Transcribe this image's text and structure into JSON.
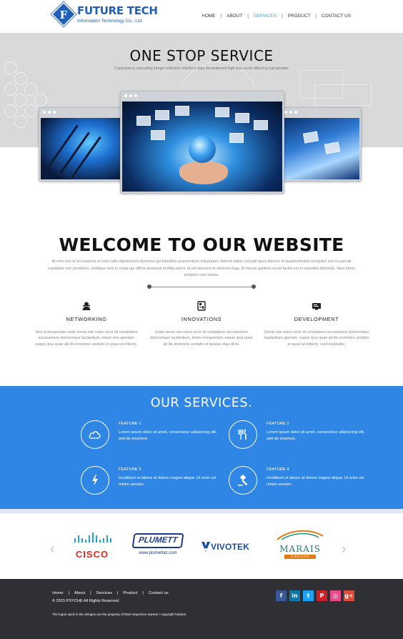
{
  "header": {
    "logo": {
      "name": "FUTURE TECH",
      "sub": "Information Technology Co., Ltd."
    },
    "nav": [
      {
        "label": "HOME",
        "active": false
      },
      {
        "label": "ABOUT",
        "active": false
      },
      {
        "label": "SERVICES",
        "active": true
      },
      {
        "label": "PRODUCT",
        "active": false
      },
      {
        "label": "CONTACT US",
        "active": false
      }
    ]
  },
  "hero": {
    "title": "ONE STOP SERVICE",
    "subtitle": "Capacitance cascading integer reflective interface data development high bus cache dithering transponder"
  },
  "welcome": {
    "title": "WELCOME TO OUR WEBSITE",
    "text": "At vero eos et accusamus et iusto odio dignissimos ducimus qui blanditiis praesentium voluptatum deleniti atque corrupti quos dolores et quasmolestias excepturi sint occaecati cupiditate non provident, similique sunt in culpa qui officia deserunt mollitia animi, id est laborum et dolorum fuga. Et harum quidem rerum facilis est et expedita distinctio. Nam libero tempore cum soluta.",
    "columns": [
      {
        "icon": "networking-icon",
        "title": "NETWORKING",
        "text": "Sed ut perspiciatis unde omnis iste natus error sit voluptatem accusantium doloremque laudantium, totam rem aperiam, eaque ipsa quae ab illo inventore veritatis et quasi architecto."
      },
      {
        "icon": "innovations-icon",
        "title": "INNOVATIONS",
        "text": "Unde omnis iste natus error sit voluptatem accusantium doloremque laudantium, totam remaperiam, eaque ipsa quae ab illo inventore veritatis et beatae vitae dicta."
      },
      {
        "icon": "development-icon",
        "title": "DEVELOPMENT",
        "text": "Omnis iste natus error sit voluptatem accusantium doloremque laudantium aperiam, eaque ipsa quae ab illo inventore veritatis et quasi architecto. sunt explicabo."
      }
    ]
  },
  "services": {
    "title": "OUR SERVICES.",
    "features": [
      {
        "icon": "cloud-icon",
        "title": "FEATURE 1",
        "text": "Lorem ipsum dolor sit amet, consectetur adipisicing elit, sed do eiusmod."
      },
      {
        "icon": "cutlery-icon",
        "title": "FEATURE 2",
        "text": "Lorem ipsum dolor sit amet, consectetur adipisicing elit, sed do eiusmod."
      },
      {
        "icon": "lightning-icon",
        "title": "FEATURE 3",
        "text": "Incididunt ut labore et dolore magna aliqua. Ut enim ad minim veniam."
      },
      {
        "icon": "gavel-icon",
        "title": "FEATURE 4",
        "text": "Incididunt ut labore et dolore magna aliqua. Ut enim ad minim veniam."
      }
    ]
  },
  "partners": [
    {
      "name": "CISCO"
    },
    {
      "name": "PLUMETT",
      "url": "www.plumettaz.com"
    },
    {
      "name": "VIVOTEK"
    },
    {
      "name": "MARAIS",
      "sub": "GROUPE"
    }
  ],
  "footer": {
    "nav": [
      "Home",
      "About",
      "Services",
      "Product",
      "Contact us"
    ],
    "copyright": "© 2015 PSYCHE  All Rights Reserved.",
    "note": "The logos used in the designs are the property of their respective owners / copyright holders.",
    "social": [
      {
        "icon": "facebook-icon",
        "glyph": "f",
        "color": "#3b5998"
      },
      {
        "icon": "linkedin-icon",
        "glyph": "in",
        "color": "#0e76a8"
      },
      {
        "icon": "twitter-icon",
        "glyph": "t",
        "color": "#1da1f2"
      },
      {
        "icon": "pinterest-icon",
        "glyph": "P",
        "color": "#cb2027"
      },
      {
        "icon": "dribbble-icon",
        "glyph": "◎",
        "color": "#ea4c89"
      },
      {
        "icon": "googleplus-icon",
        "glyph": "g+",
        "color": "#dd4b39"
      }
    ]
  },
  "colors": {
    "accent": "#2f86e4",
    "active_nav": "#27a9e1",
    "footer": "#2f3034"
  }
}
